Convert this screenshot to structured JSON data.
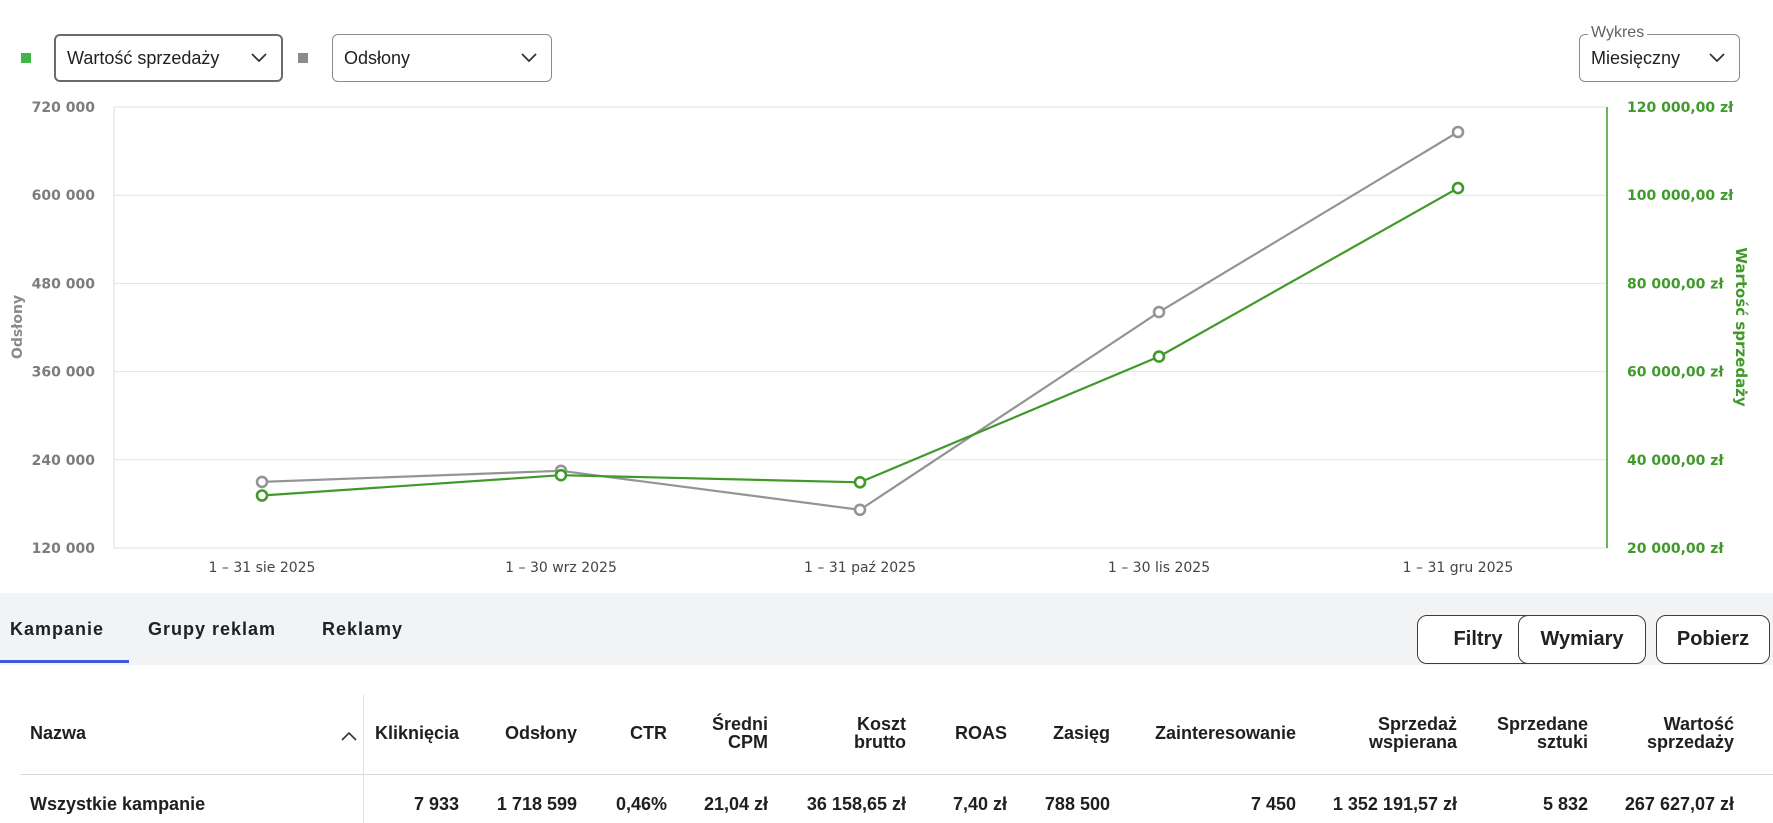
{
  "controls": {
    "primary_metric": "Wartość sprzedaży",
    "secondary_metric": "Odsłony",
    "chart_period_legend": "Wykres",
    "chart_period": "Miesięczny"
  },
  "colors": {
    "primary": "#3f9a2a",
    "secondary": "#949494",
    "tab_underline": "#3b5bdb"
  },
  "chart_data": {
    "type": "line",
    "categories": [
      "1 – 31 sie 2025",
      "1 – 30 wrz 2025",
      "1 – 31 paź 2025",
      "1 – 30 lis 2025",
      "1 – 31 gru 2025"
    ],
    "series": [
      {
        "name": "Odsłony",
        "axis": "left",
        "color": "#949494",
        "values": [
          210000,
          225000,
          172000,
          441000,
          686000
        ]
      },
      {
        "name": "Wartość sprzedaży",
        "axis": "right",
        "color": "#3f9a2a",
        "values": [
          31900,
          36500,
          34900,
          63400,
          101600
        ]
      }
    ],
    "y_left": {
      "label": "Odsłony",
      "range": [
        120000,
        720000
      ],
      "ticks": [
        "720 000",
        "600 000",
        "480 000",
        "360 000",
        "240 000",
        "120 000"
      ],
      "tick_values": [
        720000,
        600000,
        480000,
        360000,
        240000,
        120000
      ]
    },
    "y_right": {
      "label": "Wartość sprzedaży",
      "range": [
        20000,
        120000
      ],
      "ticks": [
        "120 000,00 zł",
        "100 000,00 zł",
        "80 000,00 zł",
        "60 000,00 zł",
        "40 000,00 zł",
        "20 000,00 zł"
      ]
    },
    "grid": true
  },
  "tabs": [
    {
      "label": "Kampanie",
      "active": true
    },
    {
      "label": "Grupy reklam",
      "active": false
    },
    {
      "label": "Reklamy",
      "active": false
    }
  ],
  "actions": {
    "filters": "Filtry",
    "dimensions": "Wymiary",
    "download": "Pobierz"
  },
  "table": {
    "headers": {
      "name": "Nazwa",
      "clicks": "Kliknięcia",
      "impressions": "Odsłony",
      "ctr": "CTR",
      "cpm_1": "Średni",
      "cpm_2": "CPM",
      "cost_1": "Koszt",
      "cost_2": "brutto",
      "roas": "ROAS",
      "reach": "Zasięg",
      "interest": "Zainteresowanie",
      "assisted_1": "Sprzedaż",
      "assisted_2": "wspierana",
      "units_1": "Sprzedane",
      "units_2": "sztuki",
      "value_1": "Wartość",
      "value_2": "sprzedaży"
    },
    "total_row": {
      "name": "Wszystkie kampanie",
      "clicks": "7 933",
      "impressions": "1 718 599",
      "ctr": "0,46%",
      "cpm": "21,04 zł",
      "cost": "36 158,65 zł",
      "roas": "7,40 zł",
      "reach": "788 500",
      "interest": "7 450",
      "assisted": "1 352 191,57 zł",
      "units": "5 832",
      "value": "267 627,07 zł"
    }
  }
}
